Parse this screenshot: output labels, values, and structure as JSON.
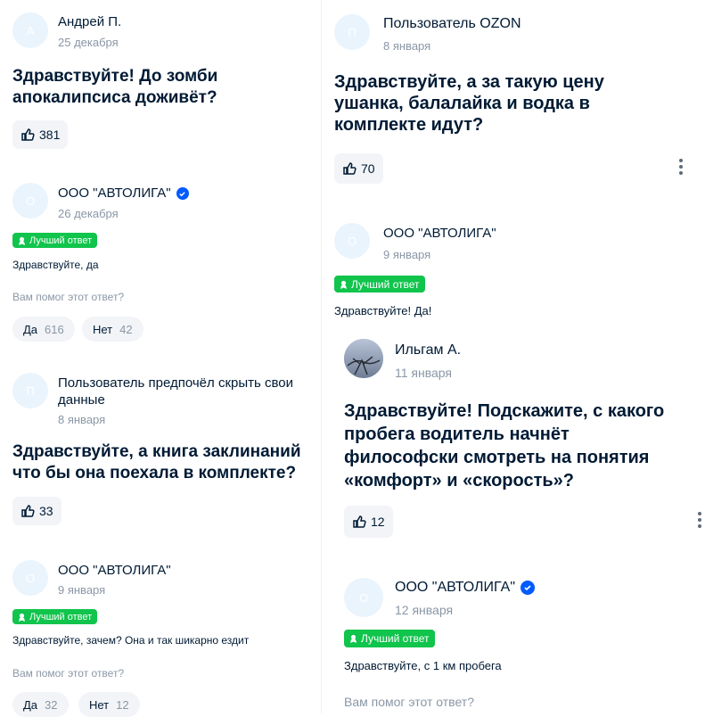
{
  "left": {
    "q1": {
      "avatar_letter": "А",
      "name": "Андрей П.",
      "date": "25 декабря",
      "text_l1": "Здравствуйте! До зомби",
      "text_l2": "апокалипсиса доживёт?",
      "likes": "381"
    },
    "a1": {
      "avatar_letter": "О",
      "name": "ООО \"АВТОЛИГА\"",
      "date": "26 декабря",
      "badge": "Лучший ответ",
      "text": "Здравствуйте, да",
      "helped": "Вам помог этот ответ?",
      "yes_label": "Да",
      "yes_count": "616",
      "no_label": "Нет",
      "no_count": "42"
    },
    "q2": {
      "avatar_letter": "П",
      "name_l1": "Пользователь предпочёл скрыть свои",
      "name_l2": "данные",
      "date": "8 января",
      "text_l1": "Здравствуйте, а книга заклинаний",
      "text_l2": "что бы она поехала в комплекте?",
      "likes": "33"
    },
    "a2": {
      "avatar_letter": "О",
      "name": "ООО \"АВТОЛИГА\"",
      "date": "9 января",
      "badge": "Лучший ответ",
      "text": "Здравствуйте, зачем? Она и так шикарно ездит",
      "helped": "Вам помог этот ответ?",
      "yes_label": "Да",
      "yes_count": "32",
      "no_label": "Нет",
      "no_count": "12"
    }
  },
  "right": {
    "q1": {
      "avatar_letter": "П",
      "name": "Пользователь OZON",
      "date": "8 января",
      "text_l1": "Здравствуйте, а за такую цену",
      "text_l2": "ушанка, балалайка и водка в",
      "text_l3": "комплекте идут?",
      "likes": "70"
    },
    "a1": {
      "avatar_letter": "О",
      "name": "ООО \"АВТОЛИГА\"",
      "date": "9 января",
      "badge": "Лучший ответ",
      "text": "Здравствуйте! Да!"
    },
    "q2": {
      "name": "Ильгам А.",
      "date": "11 января",
      "text_l1": "Здравствуйте! Подскажите, с какого",
      "text_l2": "пробега водитель начнёт",
      "text_l3": "философски смотреть на понятия",
      "text_l4": "«комфорт» и «скорость»?",
      "likes": "12"
    },
    "a2": {
      "avatar_letter": "О",
      "name": "ООО \"АВТОЛИГА\"",
      "date": "12 января",
      "badge": "Лучший ответ",
      "text": "Здравствуйте, с 1 км пробега",
      "helped": "Вам помог этот ответ?"
    }
  },
  "icons": {
    "like": "thumbs-up-icon",
    "badge": "award-icon",
    "verified": "verified-check-icon",
    "menu": "kebab-menu-icon"
  },
  "colors": {
    "badge_green": "#10c44c",
    "verified_blue": "#005bff",
    "text": "#001a34",
    "muted": "#8a97a6"
  }
}
